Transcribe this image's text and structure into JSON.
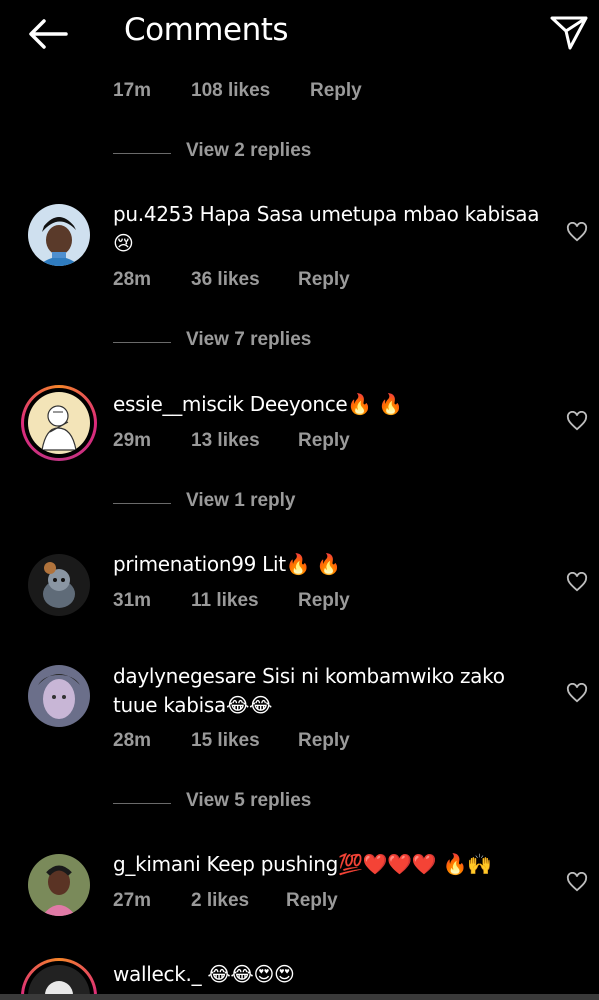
{
  "header": {
    "title": "Comments",
    "back_icon": "back-arrow-icon",
    "share_icon": "send-paper-plane-icon"
  },
  "comments": [
    {
      "time": "17m",
      "likes": "108 likes",
      "reply": "Reply",
      "view_replies": "View 2 replies"
    },
    {
      "username": "pu.4253",
      "text": "Hapa Sasa umetupa mbao kabisaa 😢",
      "time": "28m",
      "likes": "36 likes",
      "reply": "Reply",
      "view_replies": "View 7 replies"
    },
    {
      "username": "essie__miscik",
      "text": "Deeyonce🔥 🔥",
      "time": "29m",
      "likes": "13 likes",
      "reply": "Reply",
      "view_replies": "View 1 reply",
      "story_ring": true
    },
    {
      "username": "primenation99",
      "text": "Lit🔥 🔥",
      "time": "31m",
      "likes": "11 likes",
      "reply": "Reply"
    },
    {
      "username": "daylynegesare",
      "text": "Sisi ni kombamwiko zako tuue kabisa😂😂",
      "time": "28m",
      "likes": "15 likes",
      "reply": "Reply",
      "view_replies": "View 5 replies"
    },
    {
      "username": "g_kimani",
      "text": "Keep pushing💯❤️❤️❤️ 🔥🙌",
      "time": "27m",
      "likes": "2 likes",
      "reply": "Reply"
    },
    {
      "username": "walleck._",
      "text": "😂😂😍😍",
      "story_ring": true
    }
  ],
  "colors": {
    "background": "#000000",
    "primary_text": "#ffffff",
    "secondary_text": "#9a9a9a",
    "heart_outline": "#bdbdbd"
  }
}
